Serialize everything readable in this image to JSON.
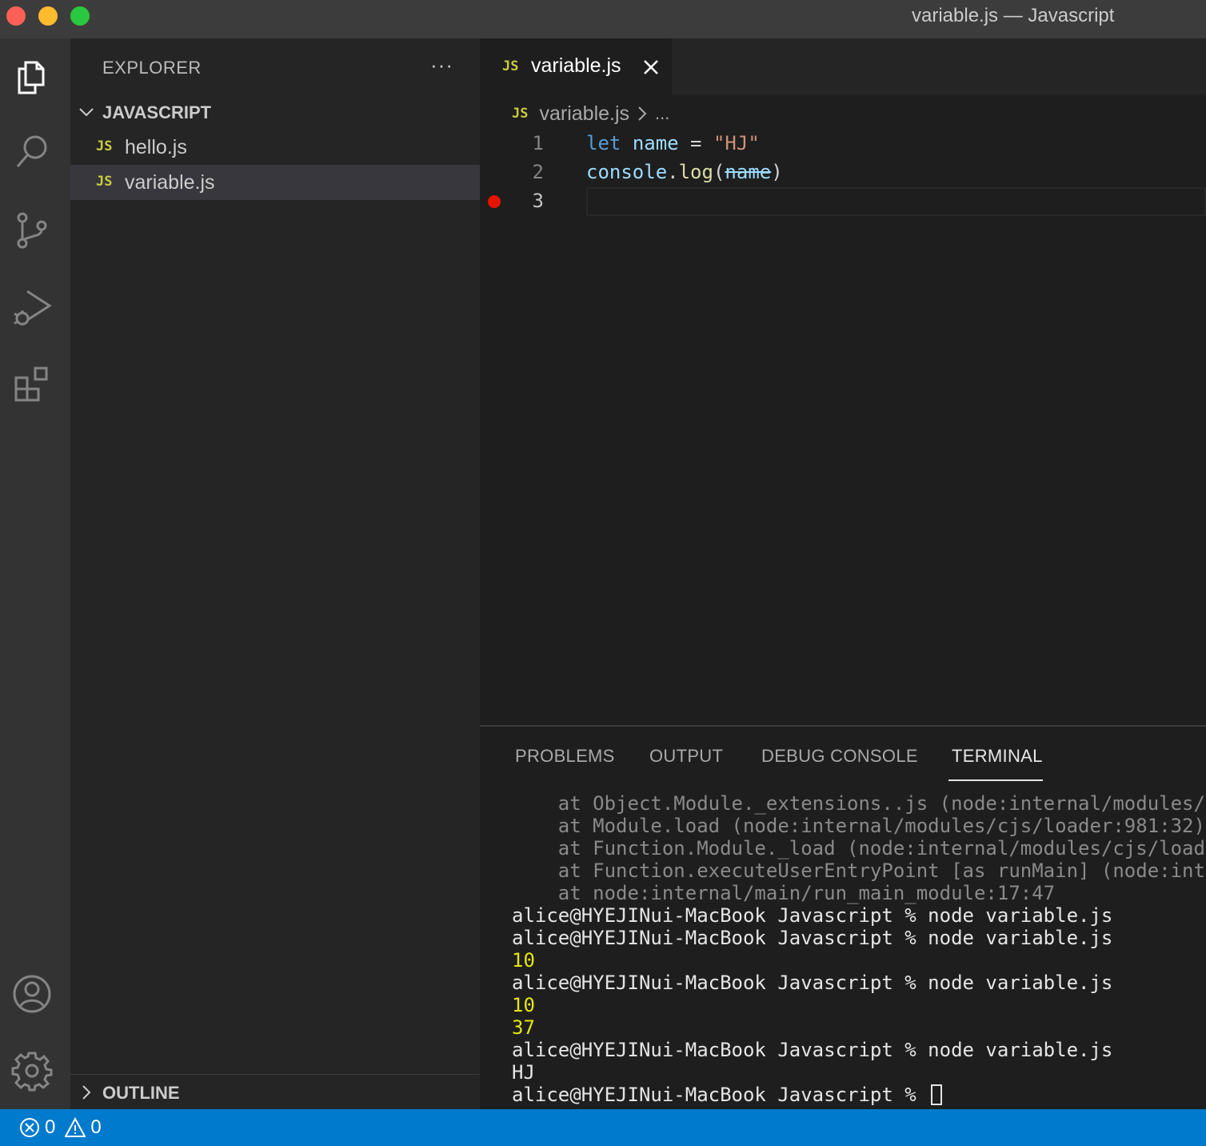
{
  "window": {
    "title": "variable.js — Javascript"
  },
  "activity_bar": {
    "items": [
      {
        "name": "explorer",
        "icon": "files-icon"
      },
      {
        "name": "search",
        "icon": "search-icon"
      },
      {
        "name": "source-control",
        "icon": "source-control-icon"
      },
      {
        "name": "run-debug",
        "icon": "run-debug-icon"
      },
      {
        "name": "extensions",
        "icon": "extensions-icon"
      }
    ],
    "bottom": [
      {
        "name": "accounts",
        "icon": "account-icon"
      },
      {
        "name": "manage",
        "icon": "gear-icon"
      }
    ]
  },
  "sidebar": {
    "title": "EXPLORER",
    "more": "···",
    "folder": "JAVASCRIPT",
    "files": [
      {
        "badge": "JS",
        "label": "hello.js",
        "selected": false
      },
      {
        "badge": "JS",
        "label": "variable.js",
        "selected": true
      }
    ],
    "outline": "OUTLINE"
  },
  "editor": {
    "tab": {
      "badge": "JS",
      "label": "variable.js"
    },
    "breadcrumb": {
      "badge": "JS",
      "file": "variable.js",
      "more": "..."
    },
    "lines": [
      {
        "num": "1",
        "tokens": [
          [
            "kw",
            "let"
          ],
          [
            "op",
            " "
          ],
          [
            "var",
            "name"
          ],
          [
            "op",
            " = "
          ],
          [
            "str",
            "\"HJ\""
          ]
        ]
      },
      {
        "num": "2",
        "tokens": [
          [
            "var",
            "console"
          ],
          [
            "op",
            "."
          ],
          [
            "fn",
            "log"
          ],
          [
            "op",
            "("
          ],
          [
            "var strike",
            "name"
          ],
          [
            "op",
            ")"
          ]
        ]
      },
      {
        "num": "3",
        "tokens": []
      }
    ],
    "breakpoint_color": "#e51400"
  },
  "panel": {
    "tabs": [
      {
        "label": "PROBLEMS",
        "active": false
      },
      {
        "label": "OUTPUT",
        "active": false
      },
      {
        "label": "DEBUG CONSOLE",
        "active": false
      },
      {
        "label": "TERMINAL",
        "active": true
      }
    ],
    "terminal_lines": [
      {
        "style": "dim",
        "text": "    at Object.Module._extensions..js (node:internal/modules/cj"
      },
      {
        "style": "dim",
        "text": "    at Module.load (node:internal/modules/cjs/loader:981:32)"
      },
      {
        "style": "dim",
        "text": "    at Function.Module._load (node:internal/modules/cjs/loader"
      },
      {
        "style": "dim",
        "text": "    at Function.executeUserEntryPoint [as runMain] (node:inter"
      },
      {
        "style": "dim",
        "text": "    at node:internal/main/run_main_module:17:47"
      },
      {
        "style": "norm",
        "text": "alice@HYEJINui-MacBook Javascript % node variable.js"
      },
      {
        "style": "norm",
        "text": "alice@HYEJINui-MacBook Javascript % node variable.js"
      },
      {
        "style": "yel",
        "text": "10"
      },
      {
        "style": "norm",
        "text": "alice@HYEJINui-MacBook Javascript % node variable.js"
      },
      {
        "style": "yel",
        "text": "10"
      },
      {
        "style": "yel",
        "text": "37"
      },
      {
        "style": "norm",
        "text": "alice@HYEJINui-MacBook Javascript % node variable.js"
      },
      {
        "style": "norm",
        "text": "HJ"
      },
      {
        "style": "norm",
        "text": "alice@HYEJINui-MacBook Javascript % ",
        "cursor": true
      }
    ]
  },
  "status_bar": {
    "errors": "0",
    "warnings": "0",
    "color": "#007acc"
  }
}
